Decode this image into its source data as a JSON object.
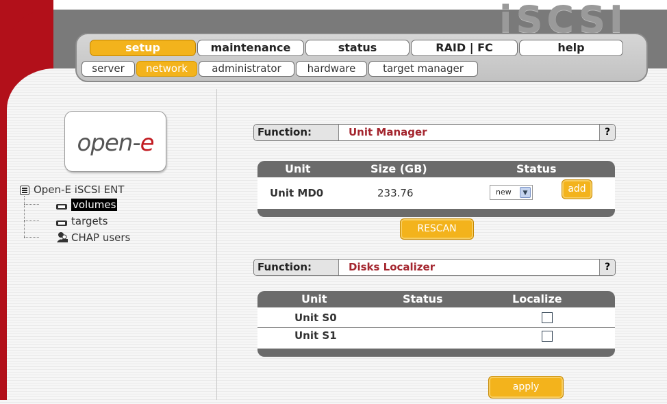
{
  "header": {
    "logo": "iSCSI",
    "tabs": [
      {
        "label": "setup",
        "active": true
      },
      {
        "label": "maintenance",
        "active": false
      },
      {
        "label": "status",
        "active": false
      },
      {
        "label": "RAID | FC",
        "active": false
      },
      {
        "label": "help",
        "active": false
      }
    ],
    "subtabs": [
      {
        "label": "server",
        "active": false
      },
      {
        "label": "network",
        "active": true
      },
      {
        "label": "administrator",
        "active": false
      },
      {
        "label": "hardware",
        "active": false
      },
      {
        "label": "target manager",
        "active": false
      }
    ]
  },
  "sidebar": {
    "logo_text": "open-",
    "logo_accent": "e",
    "tree": {
      "root": "Open-E iSCSI ENT",
      "items": [
        {
          "label": "volumes",
          "icon": "drive-icon",
          "selected": true
        },
        {
          "label": "targets",
          "icon": "drive-icon",
          "selected": false
        },
        {
          "label": "CHAP users",
          "icon": "users-icon",
          "selected": false
        }
      ]
    }
  },
  "unit_manager": {
    "function_label": "Function:",
    "function_name": "Unit Manager",
    "help": "?",
    "columns": [
      "Unit",
      "Size (GB)",
      "Status"
    ],
    "rows": [
      {
        "unit": "Unit MD0",
        "size": "233.76",
        "status": "new",
        "action": "add"
      }
    ],
    "rescan_label": "RESCAN"
  },
  "disks_localizer": {
    "function_label": "Function:",
    "function_name": "Disks Localizer",
    "help": "?",
    "columns": [
      "Unit",
      "Status",
      "Localize"
    ],
    "rows": [
      {
        "unit": "Unit S0",
        "status": "",
        "localize": false
      },
      {
        "unit": "Unit S1",
        "status": "",
        "localize": false
      }
    ],
    "apply_label": "apply"
  },
  "colors": {
    "accent": "#f3b31c",
    "brand_red": "#b2101a",
    "function_name": "#a4262f",
    "table_header": "#6b6b6b"
  }
}
